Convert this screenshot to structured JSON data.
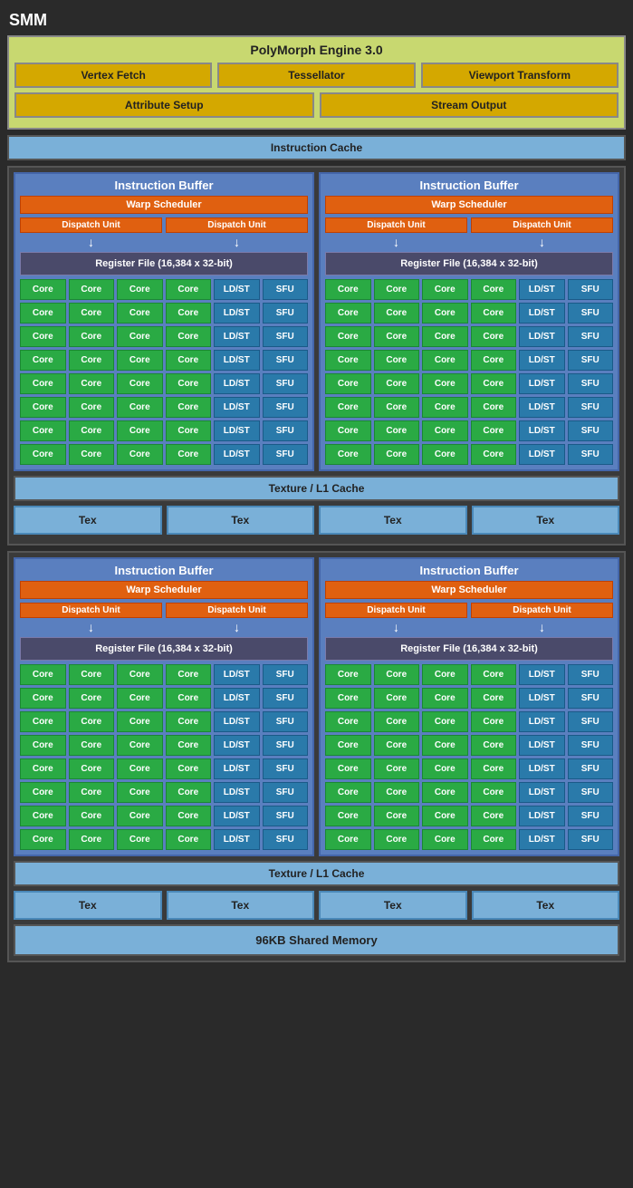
{
  "title": "SMM",
  "polymorph": {
    "title": "PolyMorph Engine 3.0",
    "row1": [
      "Vertex Fetch",
      "Tessellator",
      "Viewport Transform"
    ],
    "row2": [
      "Attribute Setup",
      "Stream Output"
    ]
  },
  "instruction_cache": "Instruction Cache",
  "texture_l1_cache": "Texture / L1 Cache",
  "shared_memory": "96KB Shared Memory",
  "sm_units": {
    "instr_buffer": "Instruction Buffer",
    "warp_scheduler": "Warp Scheduler",
    "dispatch_unit": "Dispatch Unit",
    "register_file": "Register File (16,384 x 32-bit)",
    "core": "Core",
    "ldst": "LD/ST",
    "sfu": "SFU"
  },
  "tex_units": [
    "Tex",
    "Tex",
    "Tex",
    "Tex"
  ],
  "rows_per_sm": 8
}
